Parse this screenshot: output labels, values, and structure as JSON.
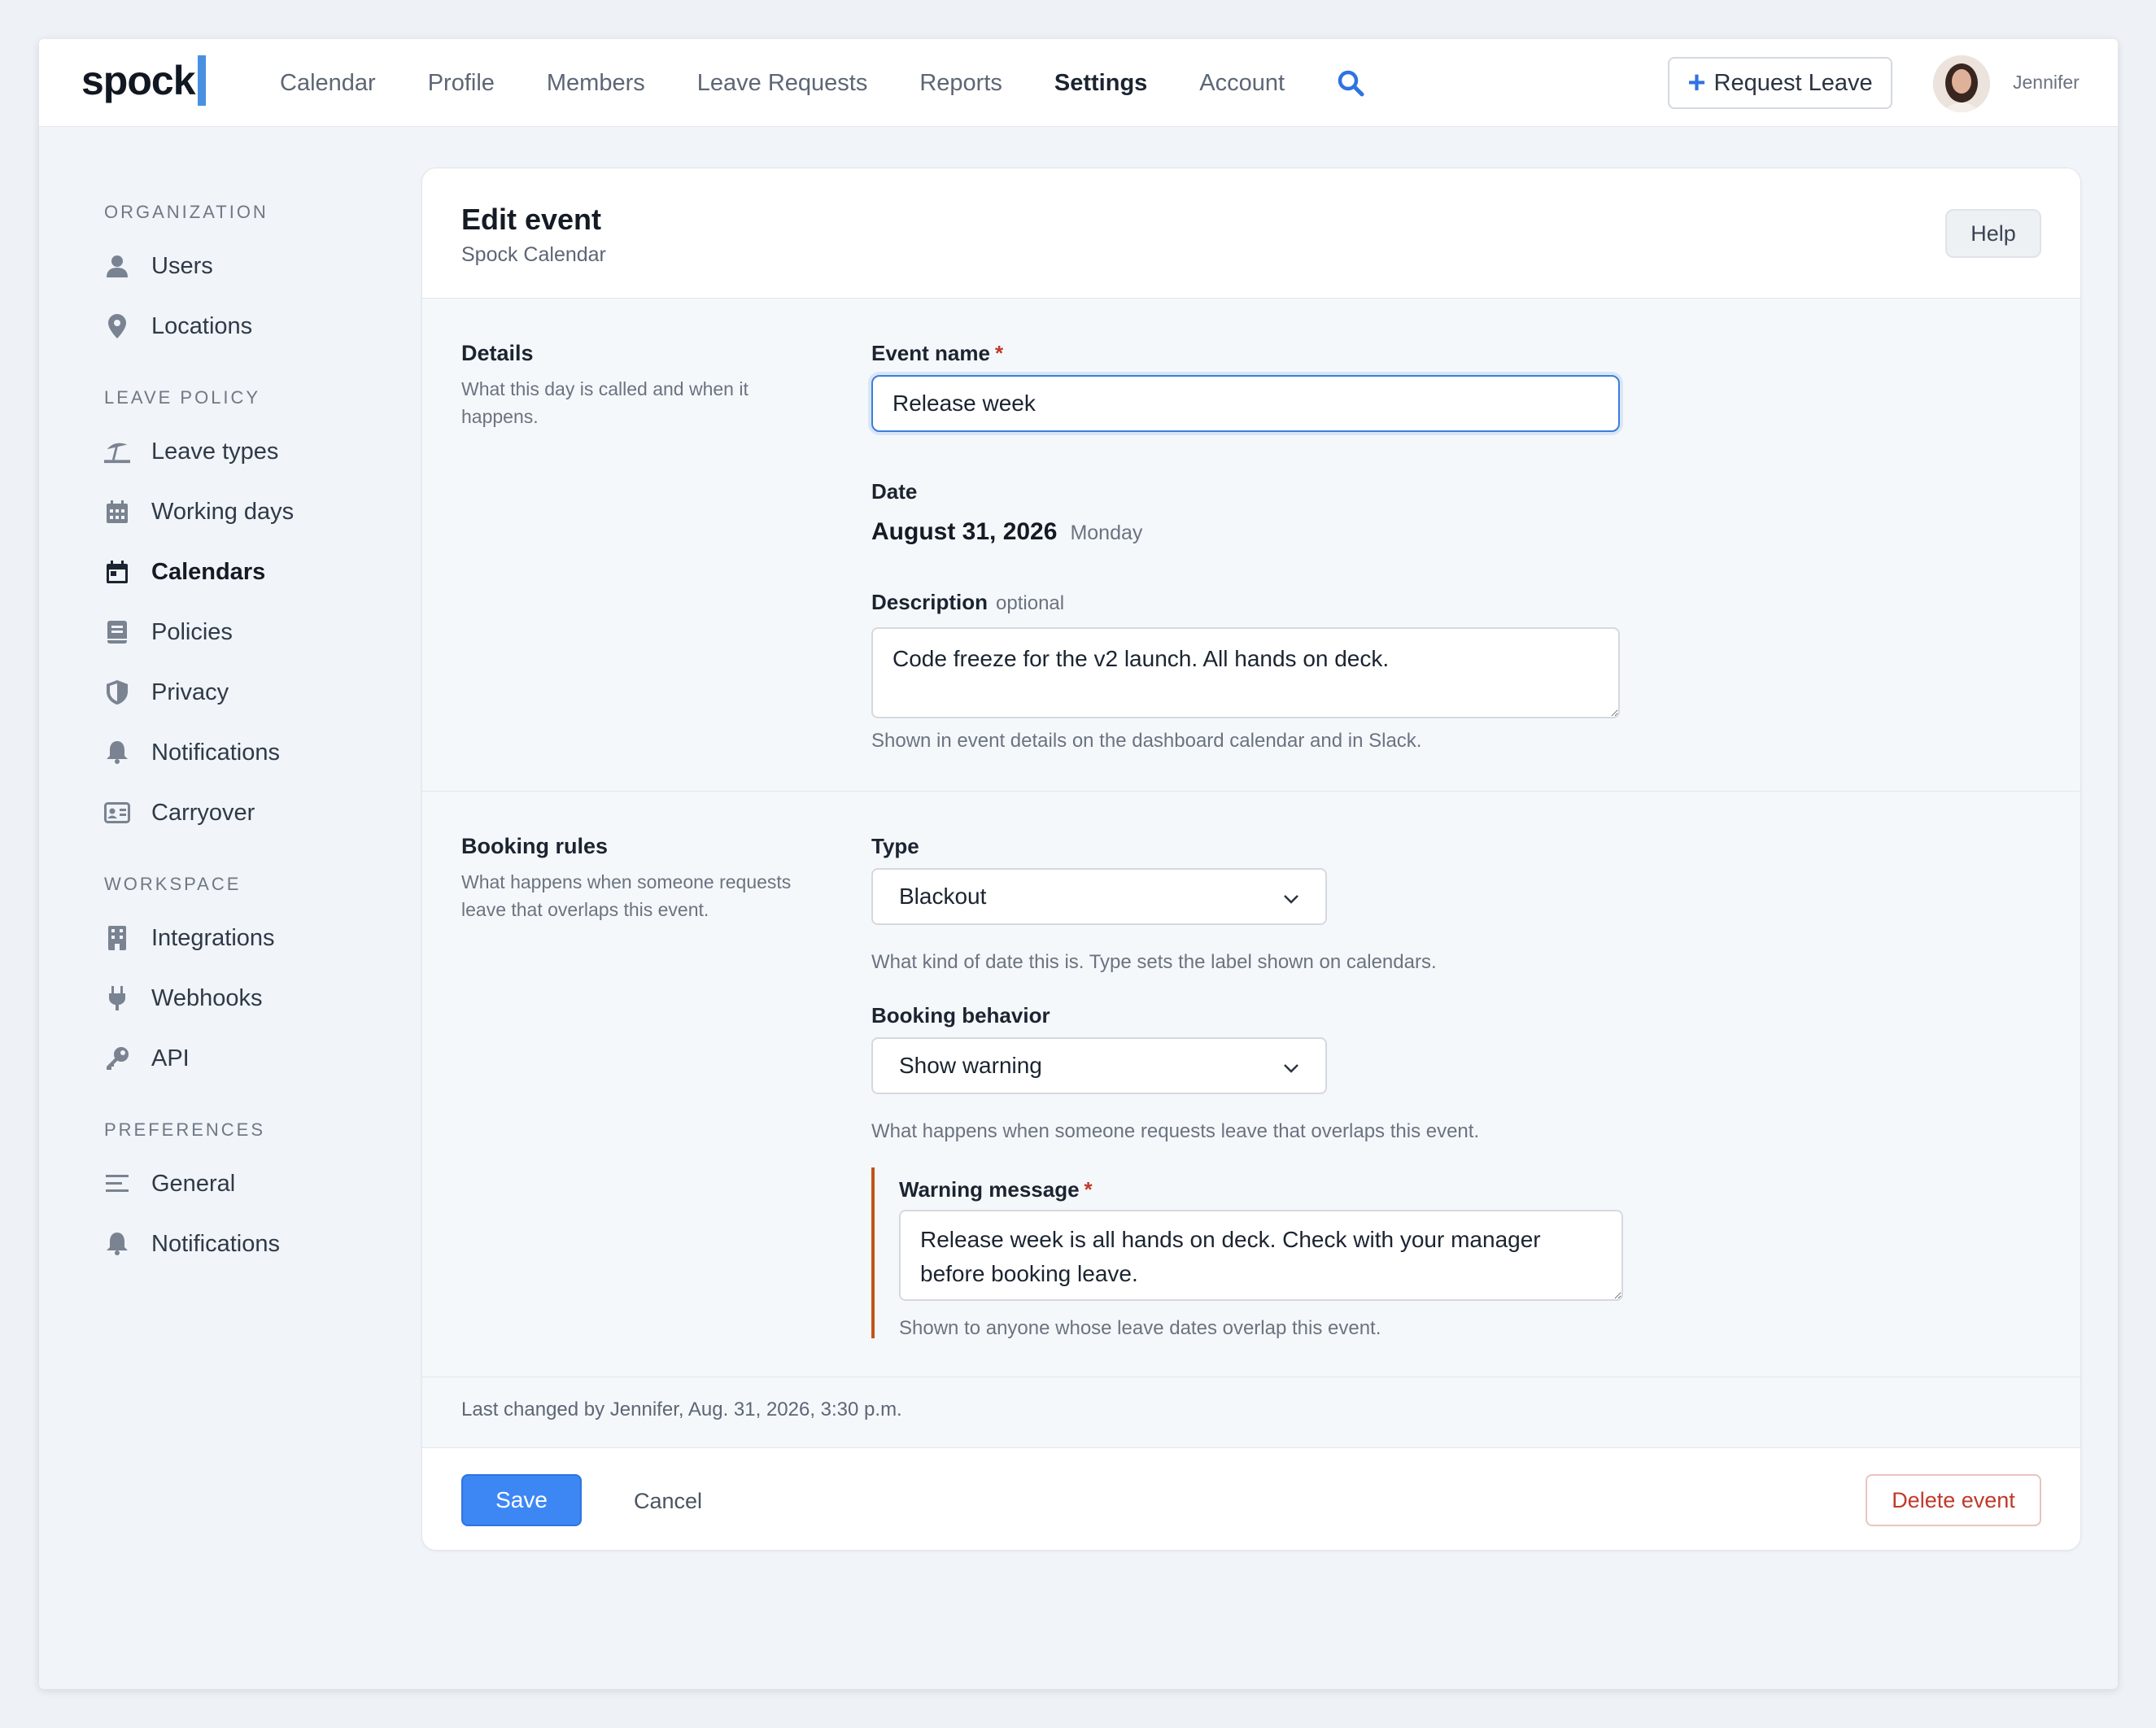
{
  "nav": {
    "logo": "spock",
    "links": [
      "Calendar",
      "Profile",
      "Members",
      "Leave Requests",
      "Reports",
      "Settings",
      "Account"
    ],
    "active": "Settings",
    "request_leave": "Request Leave",
    "user_name": "Jennifer"
  },
  "sidebar": {
    "groups": [
      {
        "heading": "ORGANIZATION",
        "items": [
          {
            "label": "Users",
            "icon": "user-icon"
          },
          {
            "label": "Locations",
            "icon": "map-pin-icon"
          }
        ]
      },
      {
        "heading": "LEAVE POLICY",
        "items": [
          {
            "label": "Leave types",
            "icon": "umbrella-beach-icon"
          },
          {
            "label": "Working days",
            "icon": "calendar-grid-icon"
          },
          {
            "label": "Calendars",
            "icon": "calendar-icon",
            "active": true
          },
          {
            "label": "Policies",
            "icon": "book-icon"
          },
          {
            "label": "Privacy",
            "icon": "shield-icon"
          },
          {
            "label": "Notifications",
            "icon": "bell-icon"
          },
          {
            "label": "Carryover",
            "icon": "id-card-icon"
          }
        ]
      },
      {
        "heading": "WORKSPACE",
        "items": [
          {
            "label": "Integrations",
            "icon": "building-icon"
          },
          {
            "label": "Webhooks",
            "icon": "plug-icon"
          },
          {
            "label": "API",
            "icon": "key-icon"
          }
        ]
      },
      {
        "heading": "PREFERENCES",
        "items": [
          {
            "label": "General",
            "icon": "lines-icon"
          },
          {
            "label": "Notifications",
            "icon": "bell-icon"
          }
        ]
      }
    ]
  },
  "card": {
    "title": "Edit event",
    "subtitle": "Spock Calendar",
    "help": "Help"
  },
  "details": {
    "title": "Details",
    "desc": "What this day is called and when it happens.",
    "event_name_label": "Event name",
    "event_name_value": "Release week",
    "date_label": "Date",
    "date_value": "August 31, 2026",
    "date_day": "Monday",
    "description_label": "Description",
    "description_optional": "optional",
    "description_value": "Code freeze for the v2 launch. All hands on deck.",
    "description_help": "Shown in event details on the dashboard calendar and in Slack."
  },
  "booking": {
    "title": "Booking rules",
    "desc": "What happens when someone requests leave that overlaps this event.",
    "type_label": "Type",
    "type_value": "Blackout",
    "type_help": "What kind of date this is. Type sets the label shown on calendars.",
    "behavior_label": "Booking behavior",
    "behavior_value": "Show warning",
    "behavior_help": "What happens when someone requests leave that overlaps this event.",
    "warning_label": "Warning message",
    "warning_value": "Release week is all hands on deck. Check with your manager before booking leave.",
    "warning_help": "Shown to anyone whose leave dates overlap this event."
  },
  "meta": "Last changed by Jennifer, Aug. 31, 2026, 3:30 p.m.",
  "footer": {
    "save": "Save",
    "cancel": "Cancel",
    "delete": "Delete event"
  },
  "required_marker": "*",
  "colors": {
    "accent": "#3d87f5",
    "danger": "#c0392b",
    "warning_bar": "#c2541a"
  }
}
